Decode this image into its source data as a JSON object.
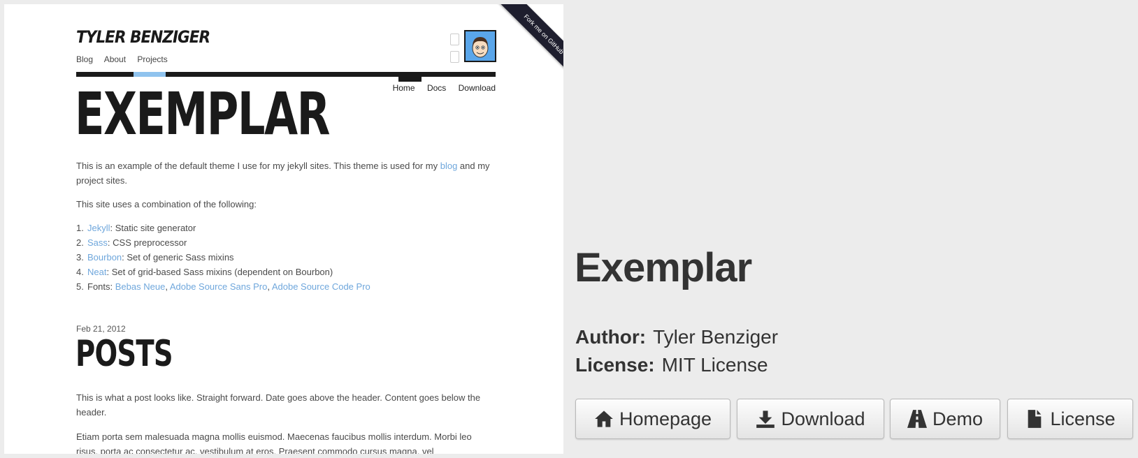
{
  "preview": {
    "site_name": "TYLER BENZIGER",
    "top_nav": [
      "Blog",
      "About",
      "Projects"
    ],
    "sub_nav": [
      "Home",
      "Docs",
      "Download"
    ],
    "ribbon": "Fork me on GitHub",
    "title": "EXEMPLAR",
    "intro_before": "This is an example of the default theme I use for my jekyll sites. This theme is used for my",
    "intro_link": "blog",
    "intro_after": "and my project sites.",
    "combo_text": "This site uses a combination of the following:",
    "list": [
      {
        "num": "1.",
        "link": "Jekyll",
        "text": ": Static site generator"
      },
      {
        "num": "2.",
        "link": "Sass",
        "text": ": CSS preprocessor"
      },
      {
        "num": "3.",
        "link": "Bourbon",
        "text": ": Set of generic Sass mixins"
      },
      {
        "num": "4.",
        "link": "Neat",
        "text": ": Set of grid-based Sass mixins (dependent on Bourbon)"
      }
    ],
    "fonts_item": {
      "num": "5.",
      "label": "Fonts: ",
      "f1": "Bebas Neue",
      "sep1": ", ",
      "f2": "Adobe Source Sans Pro",
      "sep2": ", ",
      "f3": "Adobe Source Code Pro"
    },
    "post_date": "Feb 21, 2012",
    "posts_title": "POSTS",
    "post_p1": "This is what a post looks like. Straight forward. Date goes above the header. Content goes below the header.",
    "post_p2": "Etiam porta sem malesuada magna mollis euismod. Maecenas faucibus mollis interdum. Morbi leo risus, porta ac consectetur ac, vestibulum at eros. Praesent commodo cursus magna, vel"
  },
  "details": {
    "title": "Exemplar",
    "author_label": "Author:",
    "author": "Tyler Benziger",
    "license_label": "License:",
    "license": "MIT License"
  },
  "buttons": {
    "homepage": "Homepage",
    "download": "Download",
    "demo": "Demo",
    "license": "License"
  },
  "icons": [
    "home-icon",
    "download-icon",
    "road-icon",
    "file-icon"
  ],
  "colors": {
    "link": "#6fa7dc",
    "avatar_bg": "#5aa6ea",
    "nav_highlight": "#8fc3ee",
    "page_bg": "#ececec"
  }
}
